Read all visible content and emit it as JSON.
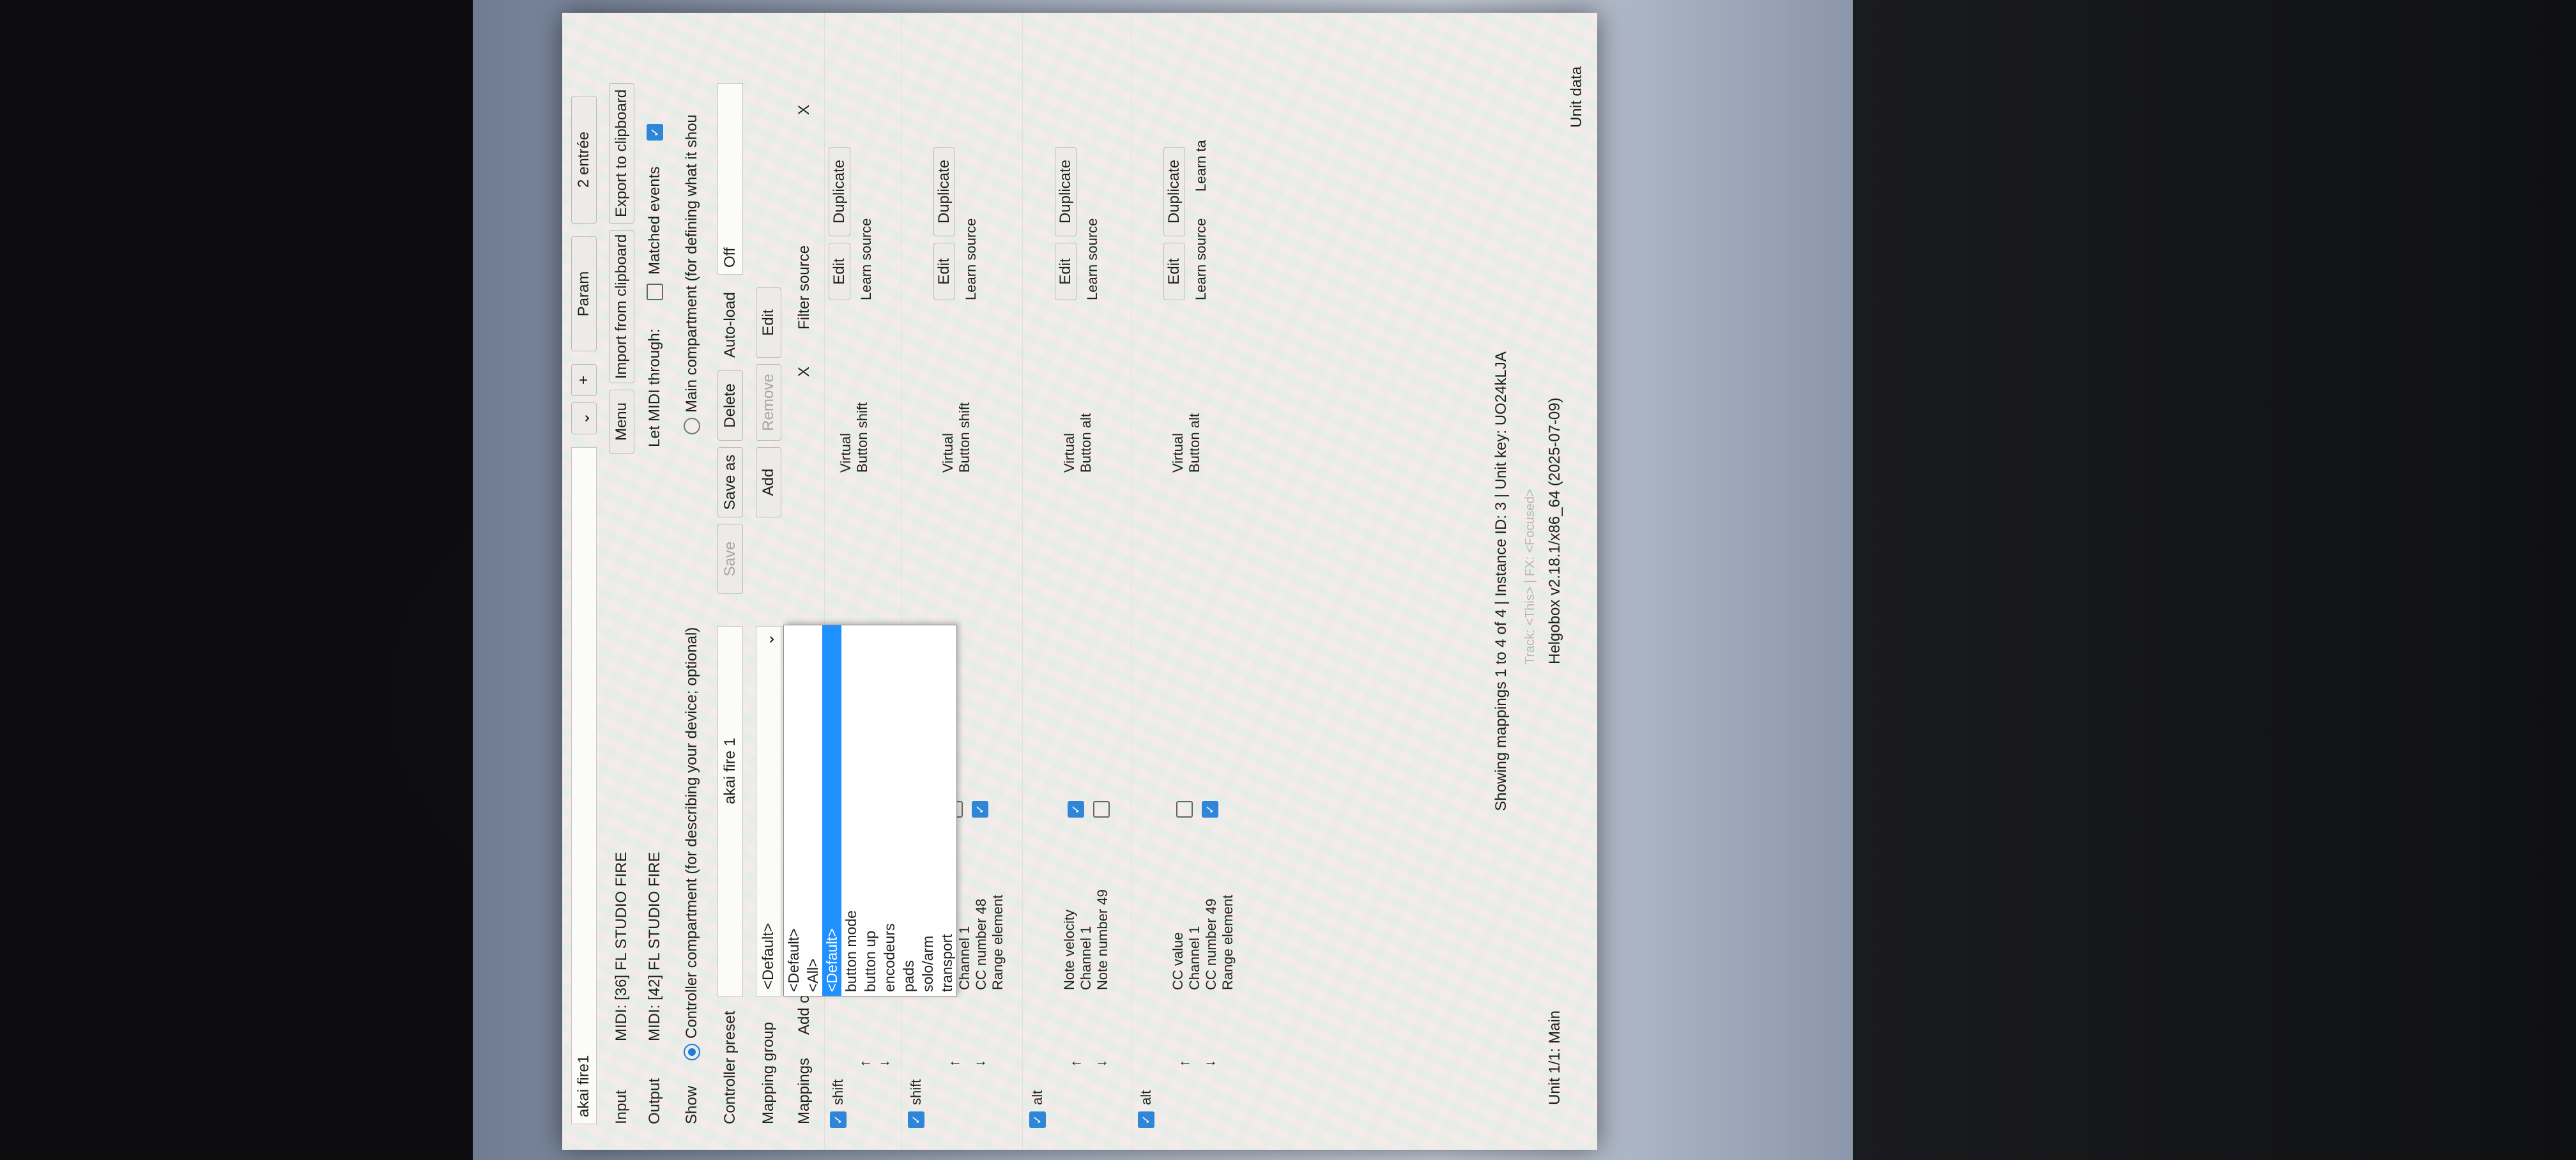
{
  "window": {
    "title": "akai fire1",
    "param_tab": "Param",
    "entree_tab": "2 entrée"
  },
  "io": {
    "input_label": "Input",
    "input_value": "MIDI: [36] FL STUDIO FIRE",
    "output_label": "Output",
    "output_value": "MIDI: [42] FL STUDIO FIRE",
    "menu_button": "Menu",
    "import_button": "Import from clipboard",
    "export_button": "Export to clipboard",
    "let_midi_through_label": "Let MIDI through:",
    "matched_events_label": "Matched events"
  },
  "show": {
    "label": "Show",
    "controller_compartment": "Controller compartment (for describing your device; optional)",
    "main_compartment": "Main compartment (for defining what it shou"
  },
  "preset": {
    "label": "Controller preset",
    "value": "akai fire 1",
    "save": "Save",
    "save_as": "Save as",
    "delete": "Delete",
    "auto_load_label": "Auto-load",
    "auto_load_value": "Off"
  },
  "mapping_group": {
    "label": "Mapping group",
    "value": "<Default>",
    "add": "Add",
    "remove": "Remove",
    "edit": "Edit",
    "options": [
      "<Default>",
      "<All>",
      "<Default>",
      "button mode",
      "button up",
      "encodeurs",
      "pads",
      "solo/arm",
      "transport"
    ]
  },
  "mappings": {
    "label": "Mappings",
    "add_prefix": "Add o",
    "filter_source": "Filter source",
    "clear_x": "X",
    "items": [
      {
        "name": "shift",
        "source": "",
        "target_type": "Virtual",
        "target": "Button shift"
      },
      {
        "name": "shift",
        "source": "CC value\nChannel 1\nCC number 48\nRange element",
        "target_type": "Virtual",
        "target": "Button shift"
      },
      {
        "name": "alt",
        "source": "Note velocity\nChannel 1\nNote number 49",
        "target_type": "Virtual",
        "target": "Button alt"
      },
      {
        "name": "alt",
        "source": "CC value\nChannel 1\nCC number 49\nRange element",
        "target_type": "Virtual",
        "target": "Button alt"
      }
    ],
    "edit": "Edit",
    "duplicate": "Duplicate",
    "learn_source": "Learn source",
    "learn_target": "Learn ta"
  },
  "status": {
    "summary": "Showing mappings 1 to 4 of 4 | Instance ID: 3 | Unit key: UO24kLJA",
    "unit": "Unit 1/1: Main",
    "track_line": "Track: <This> | FX: <Focused>",
    "version": "Helgobox v2.18.1/x86_64 (2025-07-09)",
    "unit_data": "Unit data"
  }
}
